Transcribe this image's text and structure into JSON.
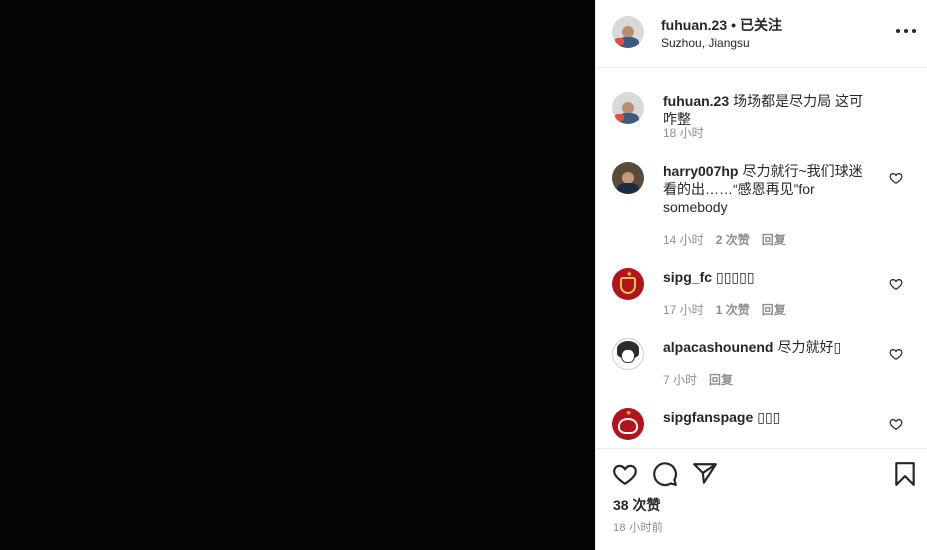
{
  "post": {
    "username": "fuhuan.23",
    "dot": "•",
    "follow_label": "已关注",
    "location": "Suzhou, Jiangsu"
  },
  "caption": {
    "username": "fuhuan.23",
    "text": "场场都是尽力局 这可咋整",
    "time": "18 小时"
  },
  "comments": [
    {
      "username": "harry007hp",
      "text": "尽力就行~我们球迷看的出……“感恩再见”for somebody",
      "time": "14 小时",
      "likes": "2 次赞",
      "reply": "回复"
    },
    {
      "username": "sipg_fc",
      "text": "▯▯▯▯▯",
      "time": "17 小时",
      "likes": "1 次赞",
      "reply": "回复"
    },
    {
      "username": "alpacashounend",
      "text": "尽力就好▯",
      "time": "7 小时",
      "likes": "",
      "reply": "回复"
    },
    {
      "username": "sipgfanspage",
      "text": "▯▯▯",
      "time": "",
      "likes": "",
      "reply": ""
    }
  ],
  "actions": {
    "likes_count": "38 次赞",
    "posted_time": "18 小时前"
  },
  "icons": {
    "more": "more-horizontal-icon",
    "like": "heart-icon",
    "comment": "comment-icon",
    "share": "send-icon",
    "save": "bookmark-icon"
  },
  "colors": {
    "text": "#262626",
    "muted": "#8e8e8e",
    "divider": "#efefef",
    "media_bg": "#050505"
  }
}
